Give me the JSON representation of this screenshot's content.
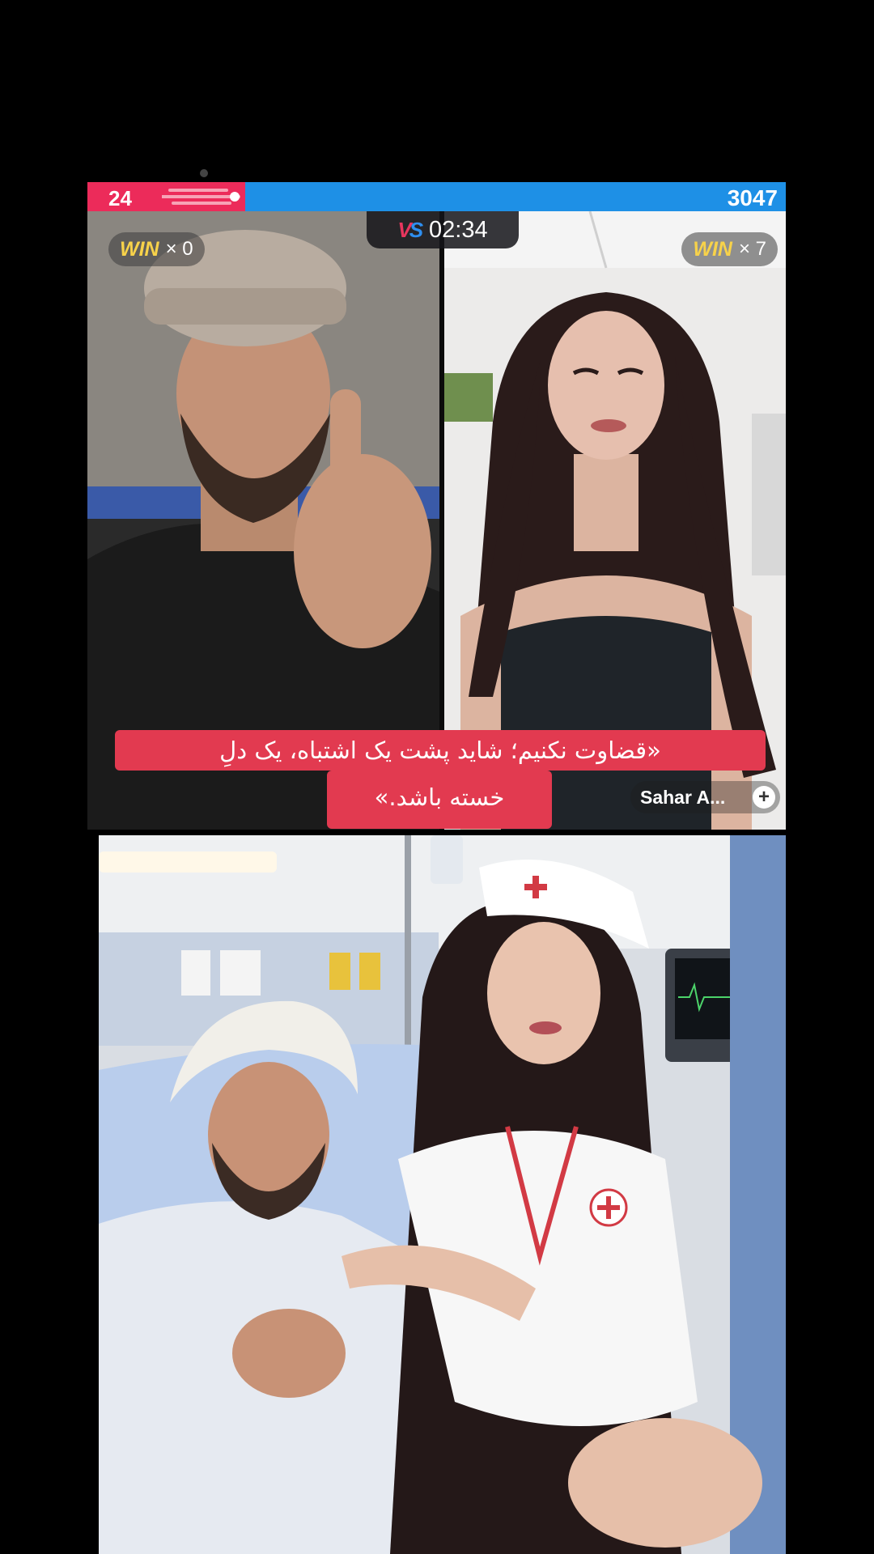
{
  "battle": {
    "left_score": "24",
    "right_score": "3047",
    "timer": "02:34",
    "vs_label": "VS",
    "left_win": {
      "word": "WIN",
      "count": "× 0"
    },
    "right_win": {
      "word": "WIN",
      "count": "× 7"
    },
    "host_name": "Sahar A...",
    "follow_icon": "plus-icon"
  },
  "caption": {
    "line1": "«قضاوت نکنیم؛ شاید پشت یک اشتباه، یک دلِ",
    "line2": "خسته باشد.»"
  },
  "colors": {
    "left_team": "#ec2b5a",
    "right_team": "#1e90e6",
    "caption_bg": "#e23a50",
    "win_gold": "#f7d24a"
  }
}
